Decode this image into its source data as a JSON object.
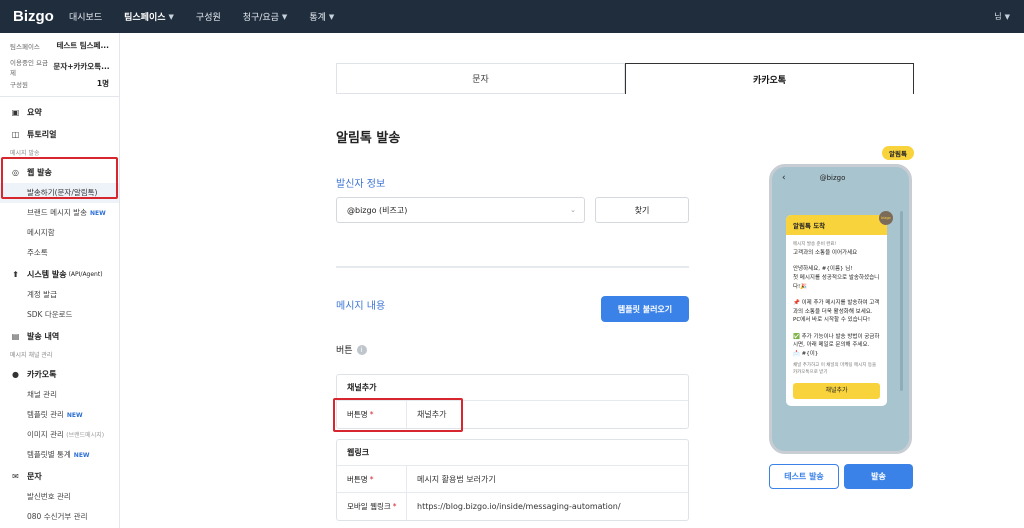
{
  "header": {
    "logo": "Bizgo",
    "nav": [
      {
        "label": "대시보드",
        "dropdown": false
      },
      {
        "label": "팀스페이스",
        "dropdown": true
      },
      {
        "label": "구성원",
        "dropdown": false
      },
      {
        "label": "청구/요금",
        "dropdown": true
      },
      {
        "label": "통계",
        "dropdown": true
      }
    ],
    "user": "님"
  },
  "sidebar": {
    "info": {
      "teamspace_label": "팀스페이스",
      "teamspace_value": "테스트 팀스페...",
      "plan_label": "이용중인 요금제",
      "plan_value": "문자+카카오톡...",
      "members_label": "구성원",
      "members_value": "1명"
    },
    "summary": "요약",
    "tutorial": "튜토리얼",
    "group_send": "메시지 발송",
    "web_send": "웹 발송",
    "web_send_items": [
      "발송하기(문자/알림톡)",
      "브랜드 메시지 발송",
      "메시지함",
      "주소록"
    ],
    "new_badge": "NEW",
    "system_send": "시스템 발송",
    "system_send_note": "(API/Agent)",
    "system_send_items": [
      "계정 발급",
      "SDK 다운로드"
    ],
    "history": "발송 내역",
    "group_channel": "메시지 채널 관리",
    "kakao": "카카오톡",
    "kakao_items": [
      "채널 관리",
      "템플릿 관리",
      "이미지 관리",
      "템플릿별 통계"
    ],
    "image_note": "(브랜드메시지)",
    "sms": "문자",
    "sms_items": [
      "발신번호 관리",
      "080 수신거부 관리"
    ]
  },
  "main": {
    "tabs": [
      "문자",
      "카카오톡"
    ],
    "active_tab": 1,
    "title": "알림톡 발송",
    "sender_title": "발신자 정보",
    "sender_select": "@bizgo (비즈고)",
    "find_button": "찾기",
    "content_title": "메시지 내용",
    "template_button": "템플릿 불러오기",
    "buttons_label": "버튼",
    "channel_card": {
      "title": "채널추가",
      "rows": [
        {
          "label": "버튼명",
          "value": "채널추가"
        }
      ]
    },
    "weblink_card": {
      "title": "웹링크",
      "rows": [
        {
          "label": "버튼명",
          "value": "메시지 활용법 보러가기"
        },
        {
          "label": "모바일 웹링크",
          "value": "https://blog.bizgo.io/inside/messaging-automation/"
        }
      ]
    }
  },
  "preview": {
    "badge": "알림톡",
    "channel": "@bizgo",
    "bubble_title": "알림톡 도착",
    "avatar_text": "bizgo",
    "lines": [
      "메시지 발송 준비 완료!",
      "고객과의 소통을 이어가세요",
      "",
      "안녕하세요, #{이름} 님!",
      "첫 메시지를 성공적으로 발송하셨습니다!🎉",
      "",
      "📌 이제 추가 메시지를 발송하여 고객과의 소통을 더욱 활성화해 보세요. PC에서 바로 시작할 수 있습니다!",
      "",
      "✅ 추가 기능이나 발송 방법이 궁금하시면, 아래 메일로 문의해 주세요.",
      "📩 #{이}"
    ],
    "small_note": "채널 추가하고 이 채널의 마케팅 메시지 등을 카카오톡으로 받기",
    "bubble_button": "채널추가",
    "test_button": "테스트 발송",
    "send_button": "발송"
  }
}
